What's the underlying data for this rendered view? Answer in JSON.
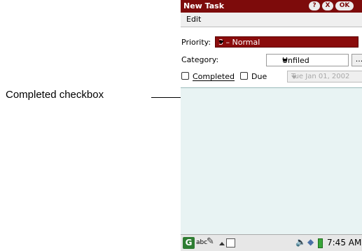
{
  "annotation": {
    "label": "Completed checkbox"
  },
  "window": {
    "title": "New Task",
    "title_buttons": [
      "?",
      "X",
      "OK"
    ]
  },
  "menu": {
    "edit": "Edit"
  },
  "form": {
    "priority_label": "Priority:",
    "priority_value": "3 – Normal",
    "category_label": "Category:",
    "category_value": "Unfiled",
    "more_label": "...",
    "completed_label": "Completed",
    "completed_checked": false,
    "due_label": "Due",
    "due_checked": false,
    "due_date": "Tue Jan 01, 2002"
  },
  "taskbar": {
    "launcher": "G",
    "input_label": "abc",
    "clock": "7:45 AM"
  },
  "colors": {
    "title_bar": "#7d0b0b",
    "priority_select": "#8a0c0c",
    "notes_area": "#e8f3f3"
  }
}
